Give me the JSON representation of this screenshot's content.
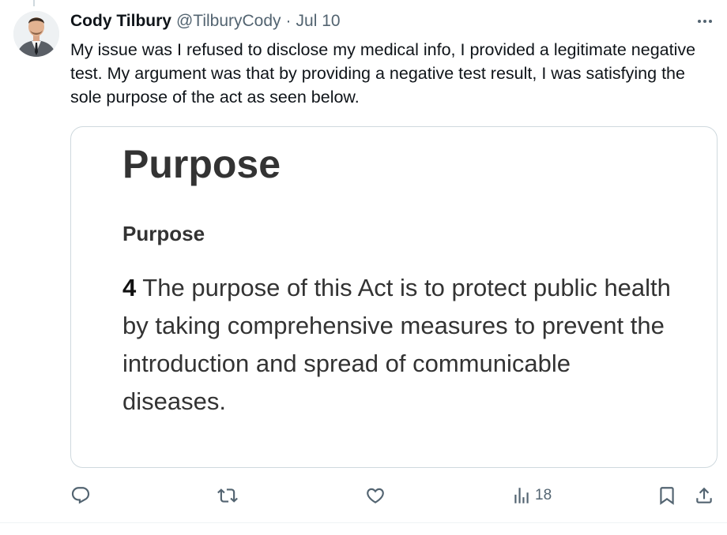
{
  "tweet": {
    "author_name": "Cody Tilbury",
    "author_handle": "@TilburyCody",
    "separator": "·",
    "date": "Jul 10",
    "text": "My issue was I refused to disclose my medical info, I provided a legitimate negative test. My argument was that by providing a negative test result, I was satisfying the sole  purpose of the act as seen below."
  },
  "media": {
    "heading": "Purpose",
    "subheading": "Purpose",
    "section_number": "4",
    "section_text": " The purpose of this Act is to protect public health by taking comprehensive measures to prevent the introduction and spread of communicable diseases."
  },
  "actions": {
    "reply_icon": "reply-icon",
    "retweet_icon": "retweet-icon",
    "like_icon": "heart-icon",
    "views_icon": "views-icon",
    "views_count": "18",
    "bookmark_icon": "bookmark-icon",
    "share_icon": "share-icon"
  },
  "colors": {
    "text": "#0f1419",
    "secondary": "#536471",
    "border": "#cfd9de",
    "doc_text": "#333333"
  }
}
